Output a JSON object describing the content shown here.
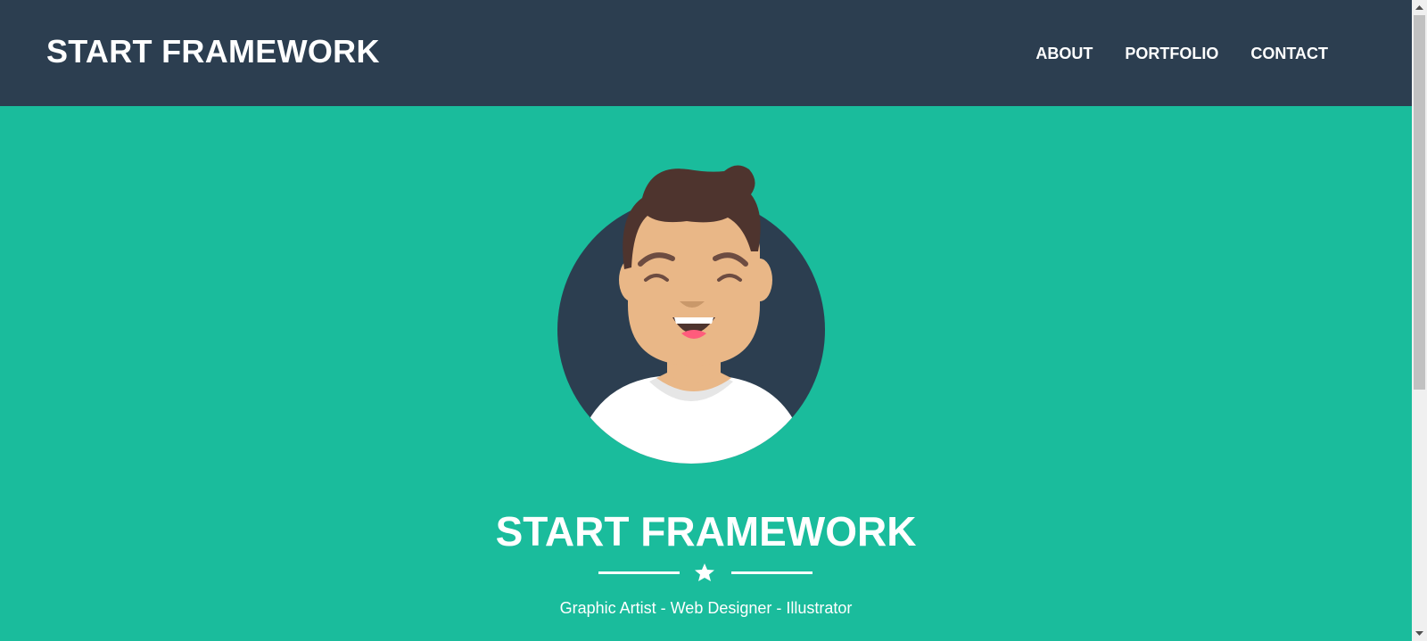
{
  "navbar": {
    "brand": "START FRAMEWORK",
    "links": [
      {
        "label": "ABOUT"
      },
      {
        "label": "PORTFOLIO"
      },
      {
        "label": "CONTACT"
      }
    ]
  },
  "hero": {
    "title": "START FRAMEWORK",
    "subtitle": "Graphic Artist - Web Designer - Illustrator",
    "divider_icon": "star-icon",
    "avatar_icon": "cartoon-avatar-icon"
  },
  "colors": {
    "navbar_bg": "#2c3e50",
    "hero_bg": "#1abc9c",
    "text": "#ffffff"
  }
}
